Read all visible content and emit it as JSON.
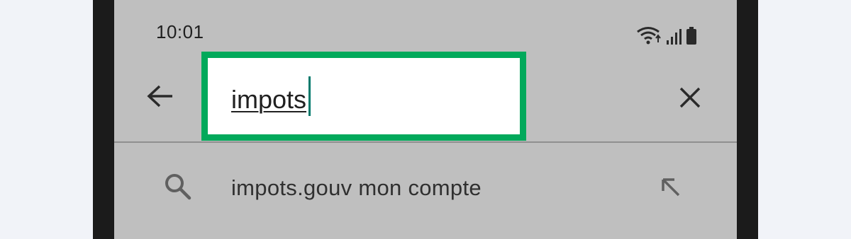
{
  "status_bar": {
    "time": "10:01",
    "icons": [
      "wifi-icon",
      "signal-icon",
      "battery-icon"
    ]
  },
  "search_bar": {
    "query": "impots",
    "back_icon": "arrow-left-icon",
    "clear_icon": "close-icon"
  },
  "suggestions": [
    {
      "text": "impots.gouv mon compte",
      "leading_icon": "search-icon",
      "trailing_icon": "arrow-up-left-icon"
    }
  ],
  "colors": {
    "highlight_border": "#02a95b",
    "screen_background": "#bfbfbf",
    "caret": "#00796b"
  }
}
